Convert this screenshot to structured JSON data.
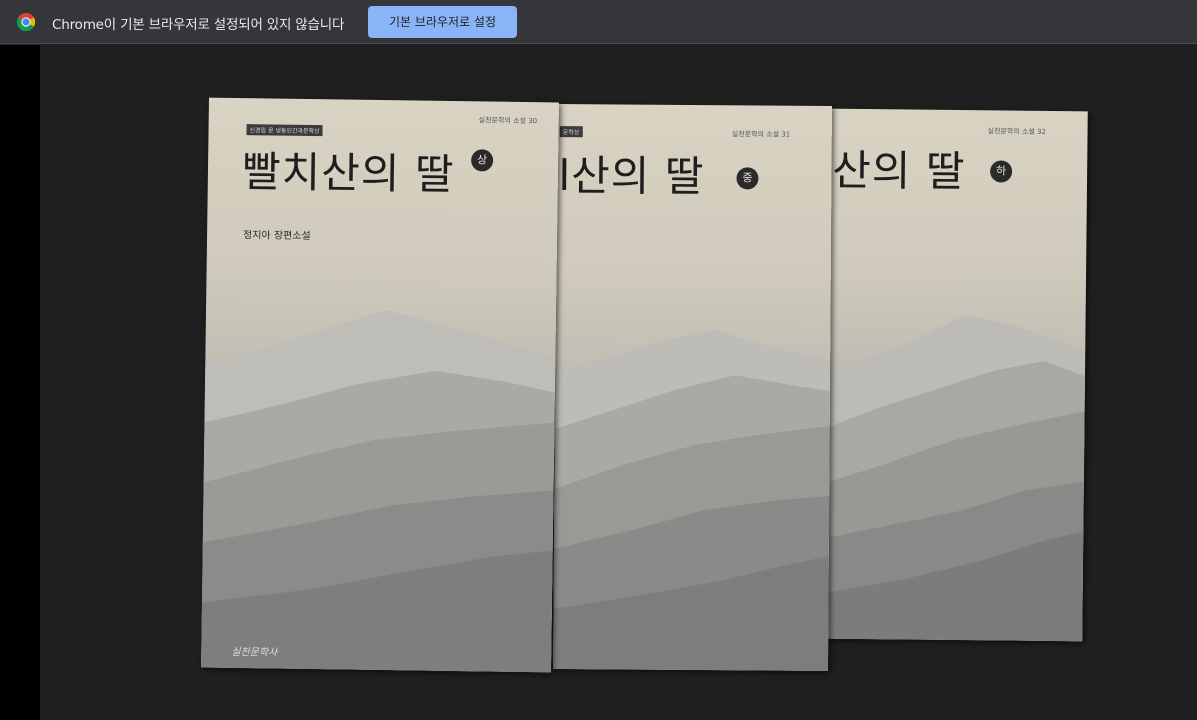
{
  "infobar": {
    "message": "Chrome이 기본 브라우저로 설정되어 있지 않습니다",
    "button_label": "기본 브라우저로 설정",
    "icon": "chrome-logo-icon"
  },
  "books": [
    {
      "series": "실천문학의 소설 30",
      "tag": "신경림 문 냉동인간과문학상",
      "title": "빨치산의 딸",
      "volume": "상",
      "author": "정지아 장편소설",
      "publisher": "실천문학사"
    },
    {
      "series": "실천문학의 소설 31",
      "tag": "문학상",
      "title": "l산의 딸",
      "volume": "중"
    },
    {
      "series": "실천문학의 소설 32",
      "title": "산의 딸",
      "volume": "하"
    }
  ]
}
